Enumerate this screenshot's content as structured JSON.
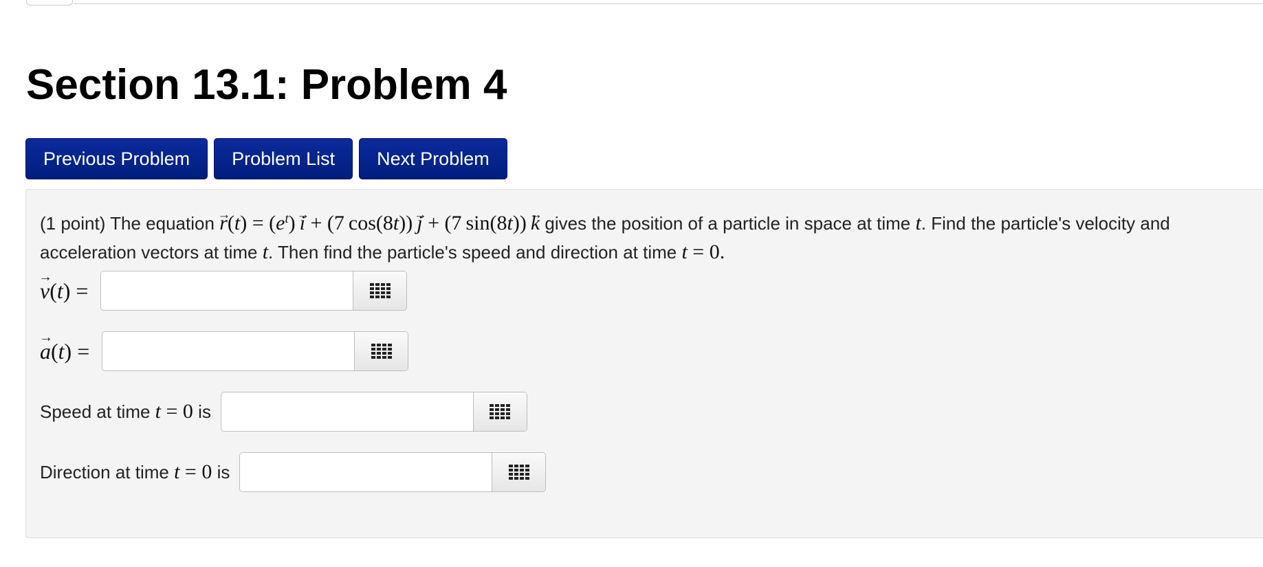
{
  "page": {
    "title": "Section 13.1: Problem 4"
  },
  "nav": {
    "previous_label": "Previous Problem",
    "list_label": "Problem List",
    "next_label": "Next Problem"
  },
  "problem": {
    "points": "(1 point)",
    "intro": "The equation",
    "equation": "r(t) = (e^t) i + (7 cos(8t)) j + (7 sin(8t)) k",
    "text_after_equation": "gives the position of a particle in space at time",
    "text_find": ". Find the particle's velocity and acceleration vectors at time",
    "text_then": ". Then find the particle's speed and direction at time",
    "time_var": "t",
    "time_value": "t = 0",
    "period": "."
  },
  "answers": [
    {
      "label_math": "v(t) =",
      "value": "",
      "placeholder": ""
    },
    {
      "label_math": "a(t) =",
      "value": "",
      "placeholder": ""
    },
    {
      "label_prefix": "Speed at time",
      "label_math": "t = 0",
      "label_suffix": "is",
      "value": "",
      "placeholder": ""
    },
    {
      "label_prefix": "Direction at time",
      "label_math": "t = 0",
      "label_suffix": "is",
      "value": "",
      "placeholder": ""
    }
  ],
  "icons": {
    "equation_palette": "grid-icon"
  },
  "colors": {
    "nav_button": "#001e7d",
    "panel_background": "#f4f4f4"
  }
}
